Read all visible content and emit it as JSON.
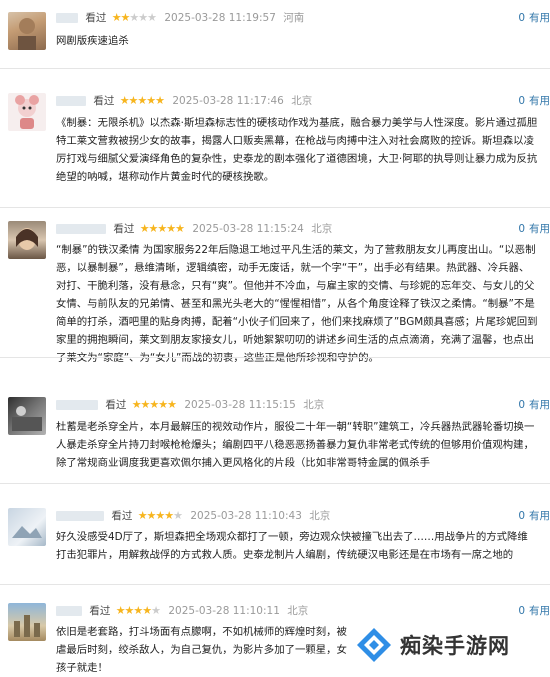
{
  "reviews": [
    {
      "watched": "看过",
      "rating": 2,
      "time": "2025-03-28 11:19:57",
      "location": "河南",
      "useful_count": "0",
      "useful_label": "有用",
      "content": "网剧版疾速追杀"
    },
    {
      "watched": "看过",
      "rating": 5,
      "time": "2025-03-28 11:17:46",
      "location": "北京",
      "useful_count": "0",
      "useful_label": "有用",
      "content": "《制暴：无限杀机》以杰森·斯坦森标志性的硬核动作戏为基底，融合暴力美学与人性深度。影片通过孤胆特工莱文营救被拐少女的故事，揭露人口贩卖黑幕，在枪战与肉搏中注入对社会腐败的控诉。斯坦森以凌厉打戏与细腻父爱演绎角色的复杂性，史泰龙的剧本强化了道德困境，大卫·阿耶的执导则让暴力成为反抗绝望的呐喊，堪称动作片黄金时代的硬核挽歌。"
    },
    {
      "watched": "看过",
      "rating": 5,
      "time": "2025-03-28 11:15:24",
      "location": "北京",
      "useful_count": "0",
      "useful_label": "有用",
      "content": "“制暴”的铁汉柔情 为国家服务22年后隐退工地过平凡生活的莱文，为了营救朋友女儿再度出山。“以恶制恶，以暴制暴”，悬维清晰，逻辑缜密，动手无废话，就一个字“干”，出手必有结果。热武器、冷兵器、对打、干脆利落，没有悬念，只有“爽”。但他并不冷血，与雇主家的交情、与珍妮的忘年交、与女儿的父女情、与前队友的兄弟情、甚至和黑光头老大的“惺惺相惜”，从各个角度诠释了铁汉之柔情。“制暴”不是简单的打杀，酒吧里的贴身肉搏，配着“小伙子们回来了，他们来找麻烦了”BGM颇具喜感；片尾珍妮回到家里的拥抱瞬间，莱文到朋友家接女儿，听她絮絮叨叨的讲述乡间生活的点点滴滴，充满了温馨，也点出了莱文为“家庭”、为“女儿”而战的初衷，这些正是他所珍视和守护的。"
    },
    {
      "watched": "看过",
      "rating": 5,
      "time": "2025-03-28 11:15:15",
      "location": "北京",
      "useful_count": "0",
      "useful_label": "有用",
      "content": "杜蓄是老杀穿全片，本月最解压的视效动作片，服役二十年一朝“转职”建筑工，冷兵器热武器轮番切换一人暴走杀穿全片持刀封喉枪枪爆头；编剧四平八稳恶恶扬善暴力复仇非常老式传统的但够用价值观构建，除了常规商业调度我更喜欢佩尔捕入更风格化的片段（比如非常哥特金属的佩杀手"
    },
    {
      "watched": "看过",
      "rating": 4,
      "time": "2025-03-28 11:10:43",
      "location": "北京",
      "useful_count": "0",
      "useful_label": "有用",
      "content": "好久没感受4D厅了，斯坦森把全场观众都打了一顿，旁边观众快被撞飞出去了……用战争片的方式降维打击犯罪片，用解救战俘的方式救人质。史泰龙制片人编剧，传统硬汉电影还是在市场有一席之地的"
    },
    {
      "watched": "看过",
      "rating": 4,
      "time": "2025-03-28 11:10:11",
      "location": "北京",
      "useful_count": "0",
      "useful_label": "有用",
      "content": "依旧是老套路，打斗场面有点朦啊，不如机械师的辉煌时刻，被虐最后时刻，绞杀敌人，为自己复仇，为影片多加了一颗星，女孩子就走！"
    }
  ],
  "watermark": {
    "text": "痴染手游网"
  }
}
